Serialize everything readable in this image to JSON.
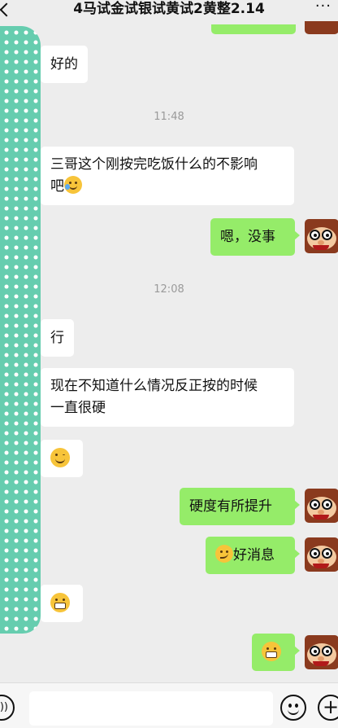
{
  "header": {
    "title": "4马试金试银试黄试2黄整2.14",
    "more": "···"
  },
  "messages": [
    {
      "side": "left",
      "text": "好的"
    },
    {
      "time": "11:48"
    },
    {
      "side": "left",
      "line1": "三哥这个刚按完吃饭什么的不影响",
      "line2": "吧",
      "emoji": "crying-laughing-emoji"
    },
    {
      "side": "right",
      "text": "嗯，没事"
    },
    {
      "time": "12:08"
    },
    {
      "side": "left",
      "text": "行"
    },
    {
      "side": "left",
      "line1": "现在不知道什么情况反正按的时候",
      "line2": "一直很硬"
    },
    {
      "side": "left",
      "emoji": "wink-emoji"
    },
    {
      "side": "right",
      "text": "硬度有所提升"
    },
    {
      "side": "right",
      "text": "好消息",
      "emoji": "smirk-emoji"
    },
    {
      "side": "left",
      "emoji": "grin-emoji"
    },
    {
      "side": "right",
      "emoji": "grimace-emoji"
    }
  ],
  "colors": {
    "background": "#ededed",
    "sent_bubble": "#95ec69",
    "received_bubble": "#ffffff",
    "redaction_dots": "#66cdaf"
  }
}
